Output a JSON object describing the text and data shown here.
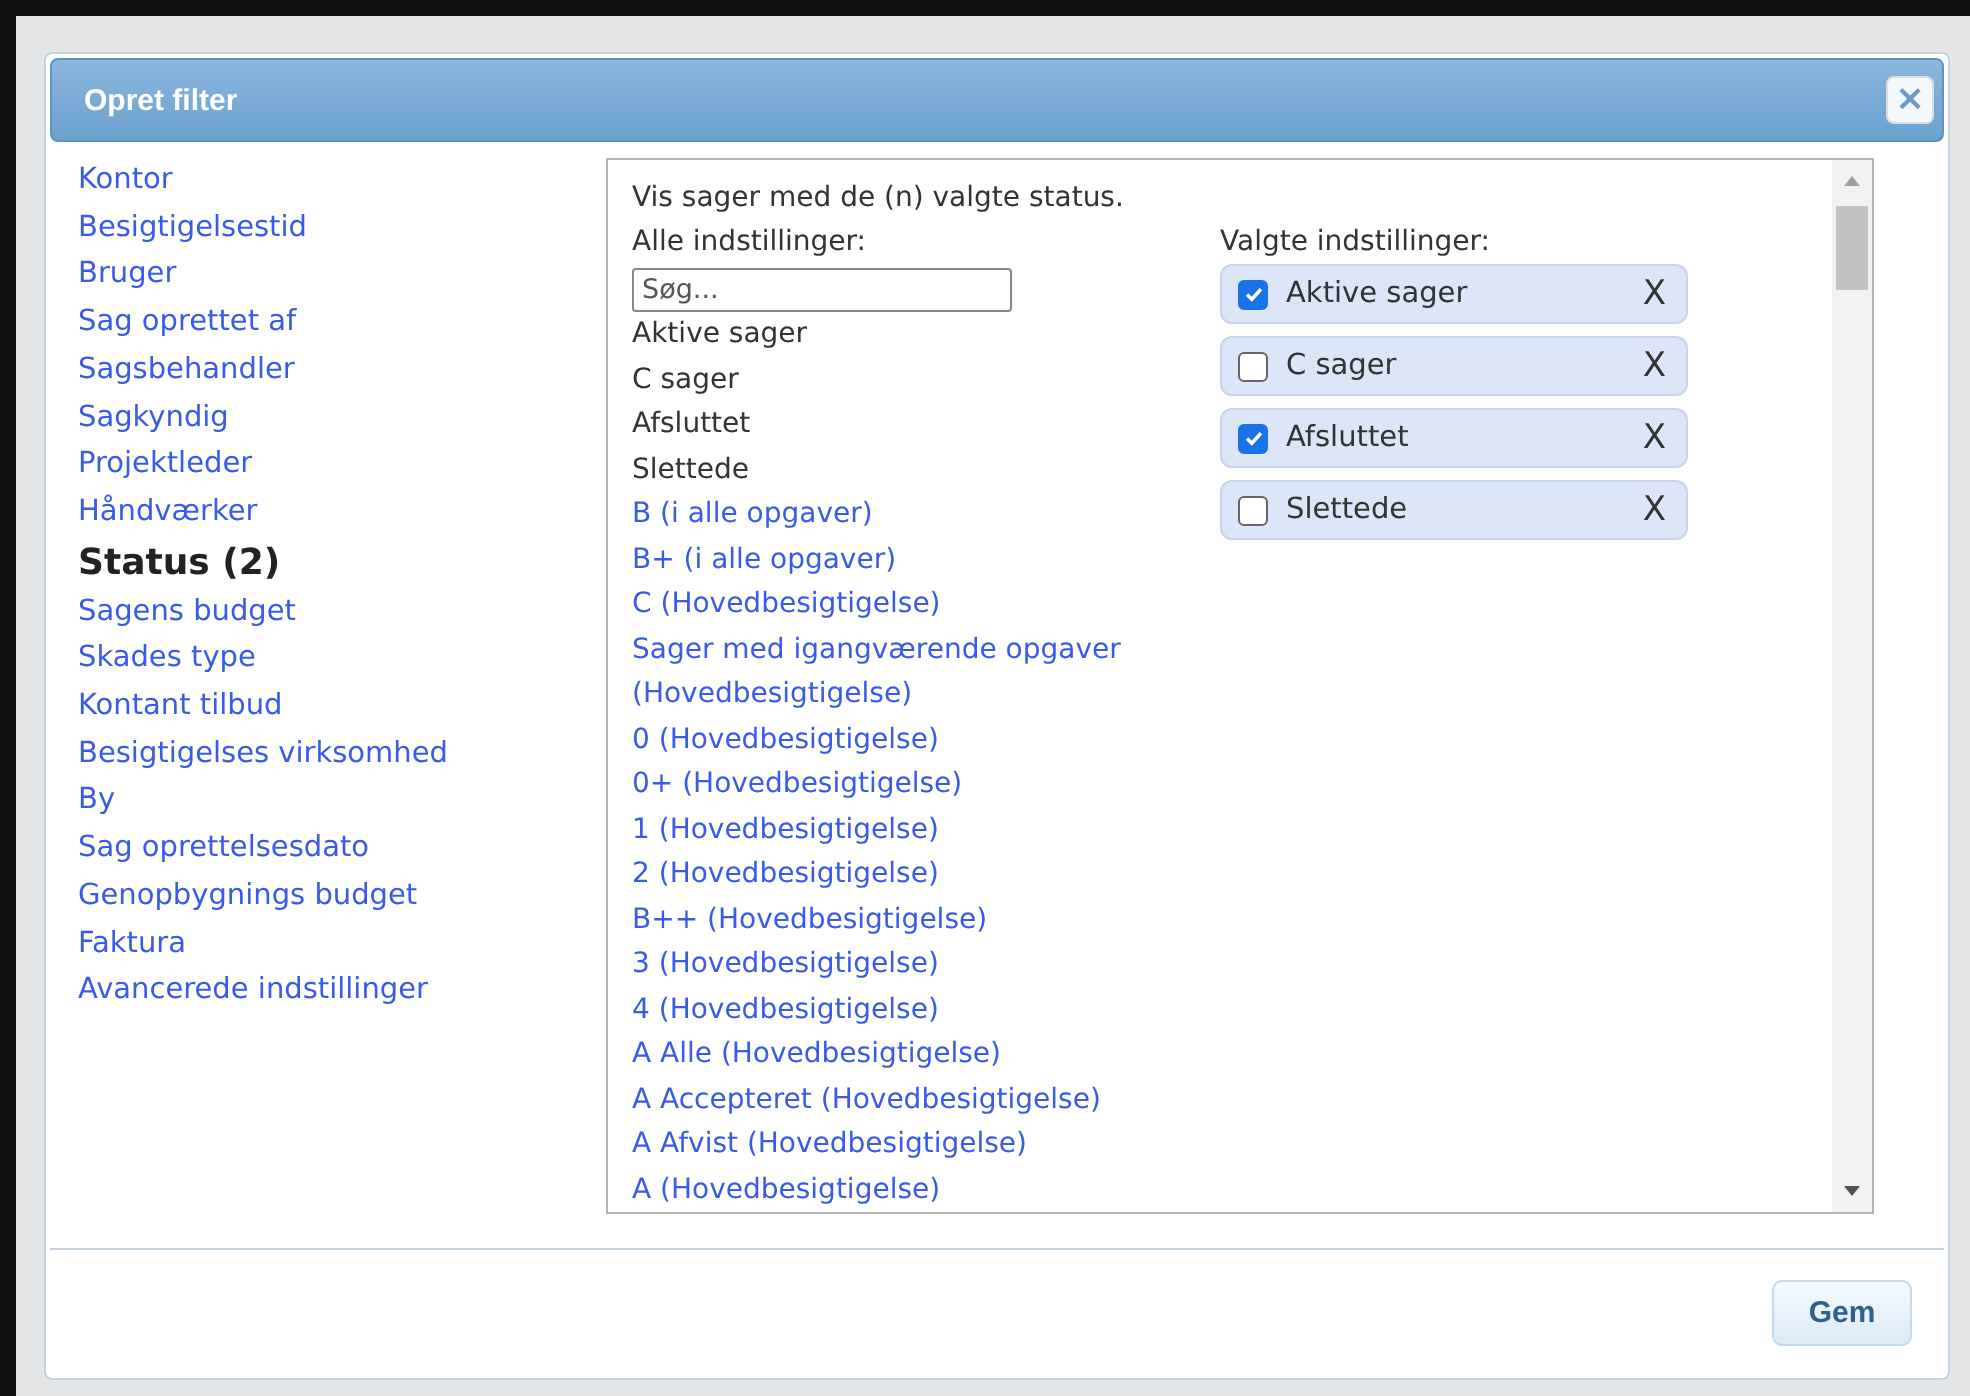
{
  "dialog": {
    "title": "Opret filter",
    "close_label": "×"
  },
  "categories": [
    {
      "label": "Kontor",
      "selected": false
    },
    {
      "label": "Besigtigelsestid",
      "selected": false
    },
    {
      "label": "Bruger",
      "selected": false
    },
    {
      "label": "Sag oprettet af",
      "selected": false
    },
    {
      "label": "Sagsbehandler",
      "selected": false
    },
    {
      "label": "Sagkyndig",
      "selected": false
    },
    {
      "label": "Projektleder",
      "selected": false
    },
    {
      "label": "Håndværker",
      "selected": false
    },
    {
      "label": "Status (2)",
      "selected": true
    },
    {
      "label": "Sagens budget",
      "selected": false
    },
    {
      "label": "Skades type",
      "selected": false
    },
    {
      "label": "Kontant tilbud",
      "selected": false
    },
    {
      "label": "Besigtigelses virksomhed",
      "selected": false
    },
    {
      "label": "By",
      "selected": false
    },
    {
      "label": "Sag oprettelsesdato",
      "selected": false
    },
    {
      "label": "Genopbygnings budget",
      "selected": false
    },
    {
      "label": "Faktura",
      "selected": false
    },
    {
      "label": "Avancerede indstillinger",
      "selected": false
    }
  ],
  "panel": {
    "description": "Vis sager med de (n) valgte status.",
    "all_heading": "Alle indstillinger:",
    "search": {
      "placeholder": "Søg..."
    },
    "selected_heading": "Valgte indstillinger:",
    "options": [
      {
        "label": "Aktive sager",
        "selected": true
      },
      {
        "label": "C sager",
        "selected": true
      },
      {
        "label": "Afsluttet",
        "selected": true
      },
      {
        "label": "Slettede",
        "selected": true
      },
      {
        "label": "B (i alle opgaver)",
        "selected": false
      },
      {
        "label": "B+ (i alle opgaver)",
        "selected": false
      },
      {
        "label": "C (Hovedbesigtigelse)",
        "selected": false
      },
      {
        "label": "Sager med igangværende opgaver (Hovedbesigtigelse)",
        "selected": false
      },
      {
        "label": "0 (Hovedbesigtigelse)",
        "selected": false
      },
      {
        "label": "0+ (Hovedbesigtigelse)",
        "selected": false
      },
      {
        "label": "1 (Hovedbesigtigelse)",
        "selected": false
      },
      {
        "label": "2 (Hovedbesigtigelse)",
        "selected": false
      },
      {
        "label": "B++ (Hovedbesigtigelse)",
        "selected": false
      },
      {
        "label": "3 (Hovedbesigtigelse)",
        "selected": false
      },
      {
        "label": "4 (Hovedbesigtigelse)",
        "selected": false
      },
      {
        "label": "A Alle (Hovedbesigtigelse)",
        "selected": false
      },
      {
        "label": "A Accepteret (Hovedbesigtigelse)",
        "selected": false
      },
      {
        "label": "A Afvist (Hovedbesigtigelse)",
        "selected": false
      },
      {
        "label": "A (Hovedbesigtigelse)",
        "selected": false
      }
    ],
    "chosen": [
      {
        "label": "Aktive sager",
        "checked": true,
        "remove": "X"
      },
      {
        "label": "C sager",
        "checked": false,
        "remove": "X"
      },
      {
        "label": "Afsluttet",
        "checked": true,
        "remove": "X"
      },
      {
        "label": "Slettede",
        "checked": false,
        "remove": "X"
      }
    ]
  },
  "buttons": [
    {
      "label": "Gem"
    }
  ]
}
